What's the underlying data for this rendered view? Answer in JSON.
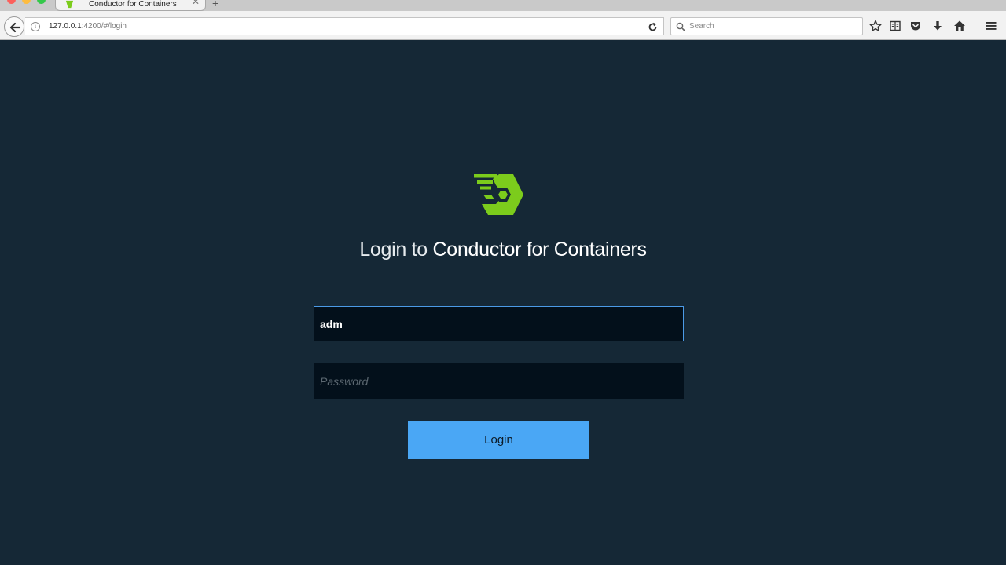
{
  "browser": {
    "tab": {
      "title": "Conductor for Containers",
      "close_glyph": "✕"
    },
    "new_tab_glyph": "+",
    "url": {
      "host": "127.0.0.1",
      "rest": ":4200/#/login"
    },
    "search": {
      "placeholder": "Search"
    },
    "icons": [
      "back-arrow-icon",
      "info-icon",
      "reload-icon",
      "search-icon",
      "bookmark-star-icon",
      "reading-list-icon",
      "pocket-icon",
      "download-icon",
      "home-icon",
      "hamburger-menu-icon"
    ]
  },
  "page": {
    "heading_prefix": "Login to ",
    "heading_brand": "Conductor for Containers",
    "username": {
      "value": "adm"
    },
    "password": {
      "placeholder": "Password",
      "value": ""
    },
    "login_button_label": "Login"
  },
  "colors": {
    "background": "#152836",
    "input_background": "#03101b",
    "input_focus_border": "#4b9ae6",
    "button": "#4aa7f5",
    "logo_green": "#7ccc1c"
  }
}
